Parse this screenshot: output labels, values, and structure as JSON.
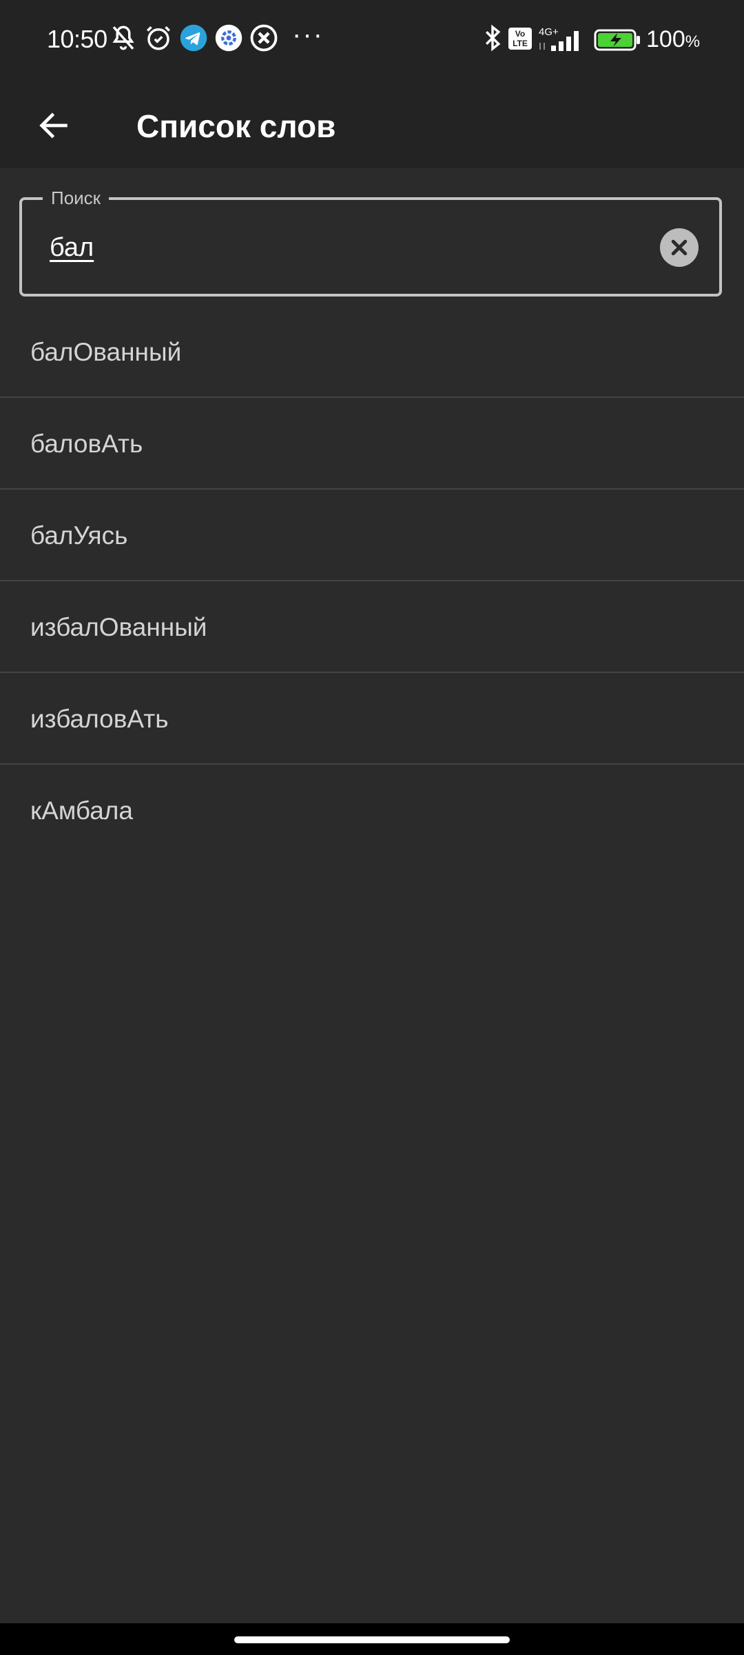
{
  "status_bar": {
    "time": "10:50",
    "battery_percent": "100",
    "battery_percent_sign": "%",
    "network": "4G+",
    "volte": "Vo LTE",
    "icons": [
      "bell-off-icon",
      "alarm-icon",
      "telegram-icon",
      "gear-icon",
      "close-circle-icon",
      "more-dots-icon",
      "bluetooth-icon",
      "volte-icon",
      "signal-icon",
      "battery-charging-icon"
    ],
    "overflow_dots": "···"
  },
  "app_bar": {
    "title": "Список слов",
    "back_icon": "arrow-left-icon"
  },
  "search": {
    "label": "Поиск",
    "value": "бал",
    "clear_icon": "close-icon"
  },
  "words": [
    {
      "text": "балОванный"
    },
    {
      "text": "баловАть"
    },
    {
      "text": "балУясь"
    },
    {
      "text": "избалОванный"
    },
    {
      "text": "избаловАть"
    },
    {
      "text": "кАмбала"
    }
  ],
  "colors": {
    "background": "#2b2b2b",
    "app_bar": "#222322",
    "divider": "#444444",
    "word_text": "#d4d4d4",
    "battery_fill": "#4cd137"
  }
}
